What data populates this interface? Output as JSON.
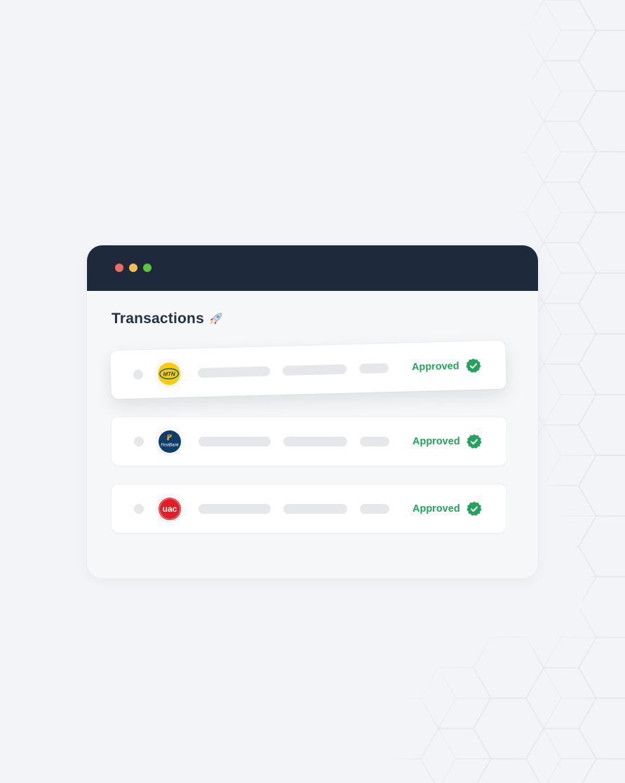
{
  "window": {
    "title_dots": [
      "close",
      "minimize",
      "maximize"
    ]
  },
  "heading": {
    "label": "Transactions",
    "icon": "rocket-icon"
  },
  "transactions": [
    {
      "logo": "mtn-logo",
      "logo_text": "MTN",
      "status": "Approved",
      "status_icon": "check-badge-icon"
    },
    {
      "logo": "firstbank-logo",
      "logo_text": "FirstBank",
      "status": "Approved",
      "status_icon": "check-badge-icon"
    },
    {
      "logo": "uac-logo",
      "logo_text": "uac",
      "status": "Approved",
      "status_icon": "check-badge-icon"
    }
  ],
  "colors": {
    "background": "#f2f4f7",
    "titlebar": "#1e293b",
    "approved": "#22a45d",
    "placeholder": "#e5e7eb"
  }
}
